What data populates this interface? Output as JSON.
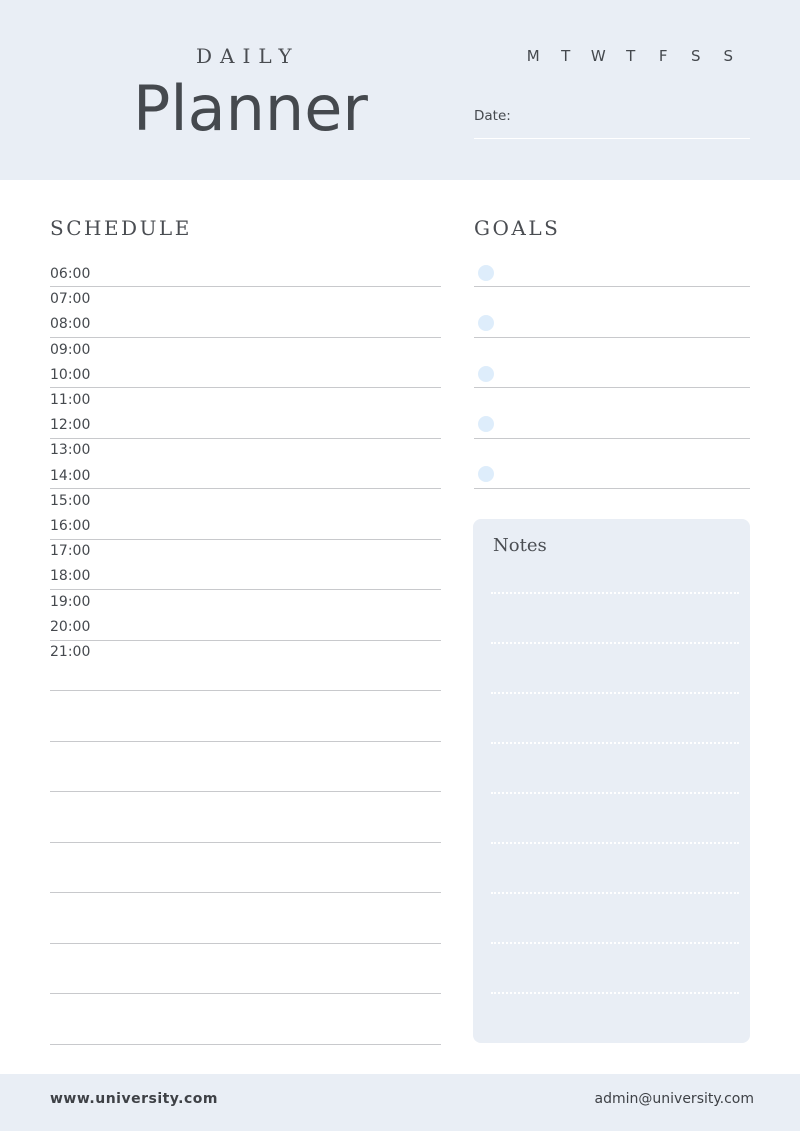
{
  "header": {
    "subtitle": "DAILY",
    "title": "Planner",
    "weekdays": [
      "M",
      "T",
      "W",
      "T",
      "F",
      "S",
      "S"
    ],
    "date_label": "Date:",
    "date_value": ""
  },
  "schedule": {
    "title": "SCHEDULE",
    "times": [
      "06:00",
      "07:00",
      "08:00",
      "09:00",
      "10:00",
      "11:00",
      "12:00",
      "13:00",
      "14:00",
      "15:00",
      "16:00",
      "17:00",
      "18:00",
      "19:00",
      "20:00",
      "21:00"
    ]
  },
  "goals": {
    "title": "GOALS",
    "items": [
      "",
      "",
      "",
      "",
      ""
    ]
  },
  "notes": {
    "title": "Notes"
  },
  "footer": {
    "website": "www.university.com",
    "email": "admin@university.com"
  },
  "colors": {
    "header_bg": "#e9eef5",
    "text": "#45494e",
    "goal_bullet": "#deedfb",
    "rule": "#c8c9cc"
  }
}
